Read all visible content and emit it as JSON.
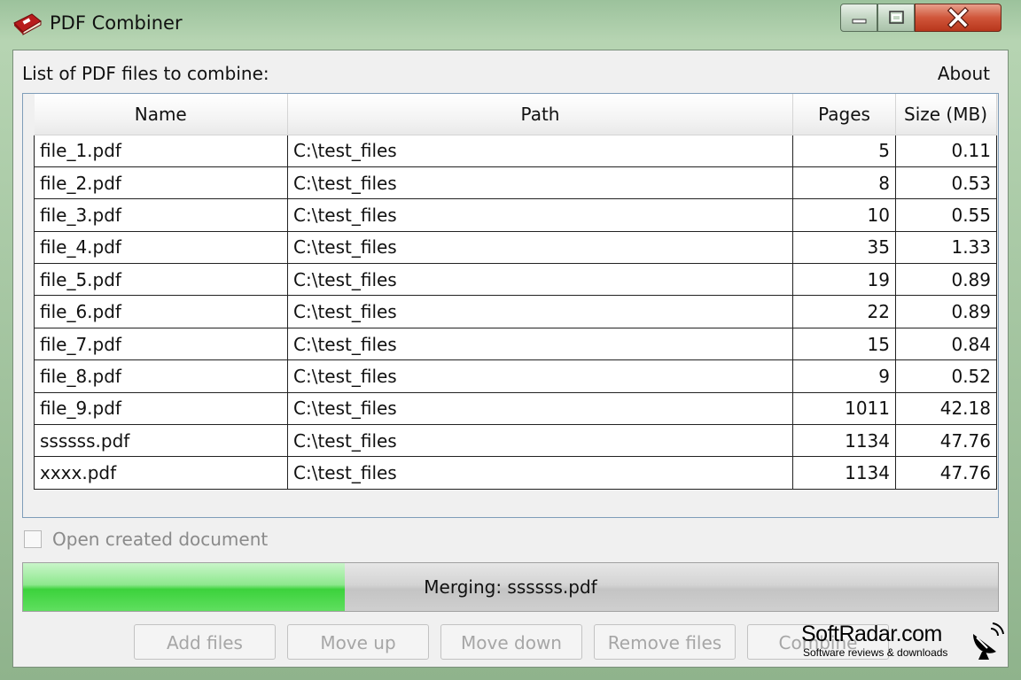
{
  "window": {
    "title": "PDF Combiner",
    "app_icon": "pdf-book-icon",
    "controls": [
      "minimize-icon",
      "maximize-icon",
      "close-icon"
    ]
  },
  "list": {
    "label": "List of PDF files to combine:",
    "about": "About",
    "columns": [
      "Name",
      "Path",
      "Pages",
      "Size (MB)"
    ],
    "rows": [
      {
        "name": "file_1.pdf",
        "path": "C:\\test_files",
        "pages": "5",
        "size": "0.11"
      },
      {
        "name": "file_2.pdf",
        "path": "C:\\test_files",
        "pages": "8",
        "size": "0.53"
      },
      {
        "name": "file_3.pdf",
        "path": "C:\\test_files",
        "pages": "10",
        "size": "0.55"
      },
      {
        "name": "file_4.pdf",
        "path": "C:\\test_files",
        "pages": "35",
        "size": "1.33"
      },
      {
        "name": "file_5.pdf",
        "path": "C:\\test_files",
        "pages": "19",
        "size": "0.89"
      },
      {
        "name": "file_6.pdf",
        "path": "C:\\test_files",
        "pages": "22",
        "size": "0.89"
      },
      {
        "name": "file_7.pdf",
        "path": "C:\\test_files",
        "pages": "15",
        "size": "0.84"
      },
      {
        "name": "file_8.pdf",
        "path": "C:\\test_files",
        "pages": "9",
        "size": "0.52"
      },
      {
        "name": "file_9.pdf",
        "path": "C:\\test_files",
        "pages": "1011",
        "size": "42.18"
      },
      {
        "name": "ssssss.pdf",
        "path": "C:\\test_files",
        "pages": "1134",
        "size": "47.76"
      },
      {
        "name": "xxxx.pdf",
        "path": "C:\\test_files",
        "pages": "1134",
        "size": "47.76"
      }
    ]
  },
  "options": {
    "open_created_label": "Open created document",
    "open_created_checked": false
  },
  "progress": {
    "text": "Merging: ssssss.pdf",
    "fraction": 0.33
  },
  "buttons": {
    "add_files": "Add files",
    "move_up": "Move up",
    "move_down": "Move down",
    "remove_files": "Remove files",
    "combine": "Combine"
  },
  "watermark": {
    "title": "SoftRadar.com",
    "subtitle": "Software reviews & downloads",
    "icon": "satellite-dish-icon"
  },
  "colors": {
    "frame": "#9cc29c",
    "progress_fill": "#3cd23c",
    "grid_border": "#7f9db9",
    "disabled_text": "#a6a6a6"
  }
}
